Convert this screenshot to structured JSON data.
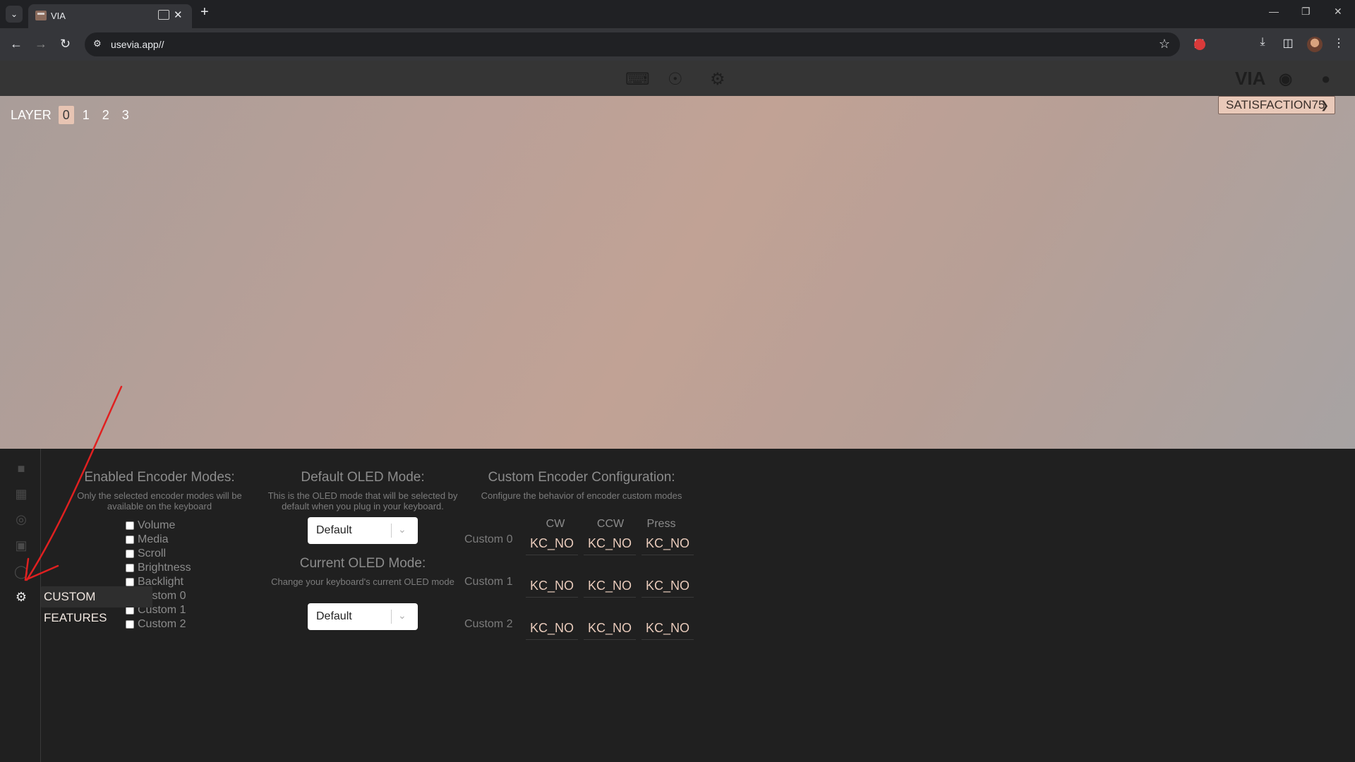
{
  "browser": {
    "tab_title": "VIA",
    "url": "usevia.app//"
  },
  "app": {
    "brand": "VIA",
    "layer_label": "LAYER",
    "layers": [
      "0",
      "1",
      "2",
      "3"
    ],
    "keyboard_name": "SATISFACTION75",
    "tooltip": "CUSTOM FEATURES"
  },
  "encoder_modes": {
    "title": "Enabled Encoder Modes:",
    "description": "Only the selected encoder modes will be available on the keyboard",
    "options": [
      "Volume",
      "Media",
      "Scroll",
      "Brightness",
      "Backlight",
      "Custom 0",
      "Custom 1",
      "Custom 2"
    ]
  },
  "default_oled": {
    "title": "Default OLED Mode:",
    "description": "This is the OLED mode that will be selected by default when you plug in your keyboard.",
    "value": "Default"
  },
  "current_oled": {
    "title": "Current OLED Mode:",
    "description": "Change your keyboard's current OLED mode",
    "value": "Default"
  },
  "custom_encoder": {
    "title": "Custom Encoder Configuration:",
    "description": "Configure the behavior of encoder custom modes",
    "headers": [
      "CW",
      "CCW",
      "Press"
    ],
    "rows": [
      {
        "label": "Custom 0",
        "cw": "KC_NO",
        "ccw": "KC_NO",
        "press": "KC_NO"
      },
      {
        "label": "Custom 1",
        "cw": "KC_NO",
        "ccw": "KC_NO",
        "press": "KC_NO"
      },
      {
        "label": "Custom 2",
        "cw": "KC_NO",
        "ccw": "KC_NO",
        "press": "KC_NO"
      }
    ]
  },
  "colors": {
    "accent": "#e9cbbb",
    "annotation": "#e02020"
  }
}
